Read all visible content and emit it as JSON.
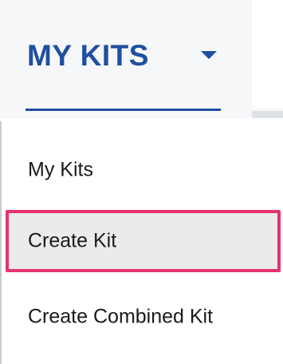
{
  "nav": {
    "tab_label": "MY KITS",
    "caret_icon": "caret-down-icon",
    "accent_color": "#1f4f9f"
  },
  "dropdown": {
    "items": [
      {
        "label": "My Kits",
        "highlighted": false
      },
      {
        "label": "Create Kit",
        "highlighted": true
      },
      {
        "label": "Create Combined Kit",
        "highlighted": false
      }
    ],
    "highlight_border_color": "#e6336d",
    "highlight_fill_color": "#eaebec"
  }
}
